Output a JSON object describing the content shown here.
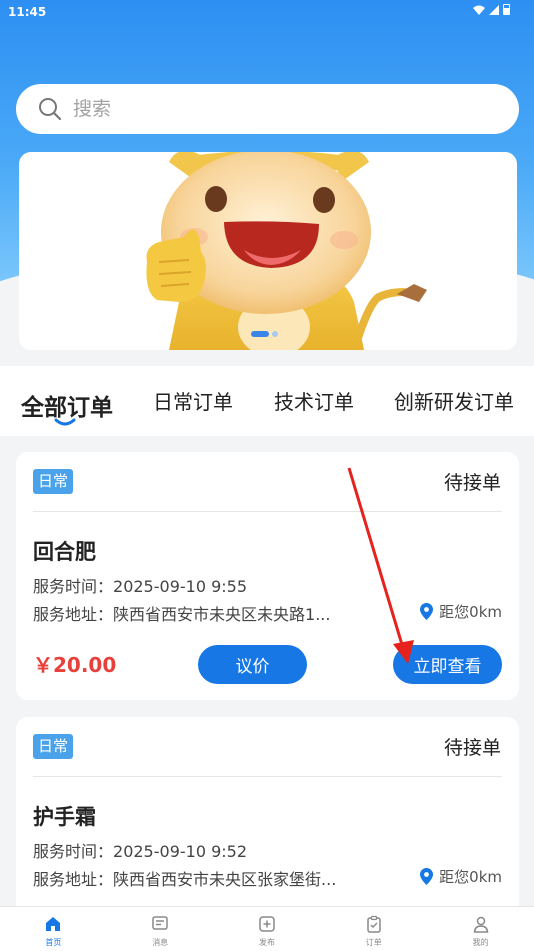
{
  "status_bar": {
    "time": "11:45"
  },
  "search": {
    "placeholder": "搜索"
  },
  "tabs": [
    {
      "label": "全部订单",
      "active": true
    },
    {
      "label": "日常订单"
    },
    {
      "label": "技术订单"
    },
    {
      "label": "创新研发订单"
    }
  ],
  "orders": [
    {
      "tag": "日常",
      "status": "待接单",
      "title": "回合肥",
      "time_label": "服务时间：",
      "time_value": "2025-09-10 9:55",
      "addr_label": "服务地址：",
      "addr_value": "陕西省西安市未央区未央路1...",
      "distance": "距您0km",
      "price": "￥20.00",
      "negotiate_label": "议价",
      "view_label": "立即查看"
    },
    {
      "tag": "日常",
      "status": "待接单",
      "title": "护手霜",
      "time_label": "服务时间：",
      "time_value": "2025-09-10 9:52",
      "addr_label": "服务地址：",
      "addr_value": "陕西省西安市未央区张家堡街...",
      "distance": "距您0km"
    }
  ],
  "bottom_nav": [
    {
      "label": "首页",
      "icon": "home-icon",
      "active": true
    },
    {
      "label": "消息",
      "icon": "message-icon"
    },
    {
      "label": "发布",
      "icon": "publish-icon"
    },
    {
      "label": "订单",
      "icon": "order-icon"
    },
    {
      "label": "我的",
      "icon": "profile-icon"
    }
  ],
  "colors": {
    "primary": "#1677e5",
    "tag_bg": "#4aa3ea",
    "price": "#e8403a",
    "header_top": "#2d8ff2"
  }
}
